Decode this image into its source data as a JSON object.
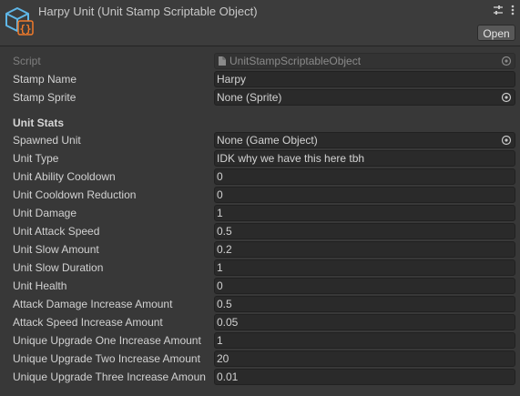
{
  "header": {
    "title": "Harpy Unit (Unit Stamp Scriptable Object)",
    "open_label": "Open"
  },
  "script": {
    "label": "Script",
    "value": "UnitStampScriptableObject"
  },
  "stamp_name": {
    "label": "Stamp Name",
    "value": "Harpy"
  },
  "stamp_sprite": {
    "label": "Stamp Sprite",
    "value": "None (Sprite)"
  },
  "section": {
    "title": "Unit Stats"
  },
  "spawned_unit": {
    "label": "Spawned Unit",
    "value": "None (Game Object)"
  },
  "stats": [
    {
      "label": "Unit Type",
      "value": "IDK why we have this here tbh"
    },
    {
      "label": "Unit Ability Cooldown",
      "value": "0"
    },
    {
      "label": "Unit Cooldown Reduction",
      "value": "0"
    },
    {
      "label": "Unit Damage",
      "value": "1"
    },
    {
      "label": "Unit Attack Speed",
      "value": "0.5"
    },
    {
      "label": "Unit Slow Amount",
      "value": "0.2"
    },
    {
      "label": "Unit Slow Duration",
      "value": "1"
    },
    {
      "label": "Unit Health",
      "value": "0"
    },
    {
      "label": "Attack Damage Increase Amount",
      "value": "0.5"
    },
    {
      "label": "Attack Speed Increase Amount",
      "value": "0.05"
    },
    {
      "label": "Unique Upgrade One Increase Amount",
      "value": "1"
    },
    {
      "label": "Unique Upgrade Two Increase Amount",
      "value": "20"
    },
    {
      "label": "Unique Upgrade Three Increase Amoun",
      "value": "0.01"
    }
  ],
  "icons": {
    "header": "scriptable-object-icon",
    "script_file": "script-file-icon",
    "object_picker": "object-picker-icon",
    "settings": "settings-sliders-icon",
    "menu": "kebab-menu-icon"
  },
  "colors": {
    "background": "#383838",
    "field": "#2a2a2a",
    "accent": "#5fb7e8",
    "accent2": "#f07a2a"
  }
}
